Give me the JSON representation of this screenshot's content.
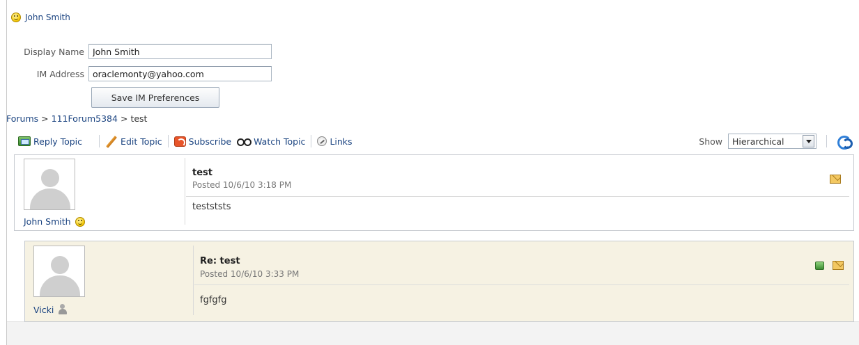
{
  "header": {
    "user_name": "John Smith"
  },
  "im_form": {
    "display_name_label": "Display Name",
    "display_name_value": "John Smith",
    "im_address_label": "IM Address",
    "im_address_value": "oraclemonty@yahoo.com",
    "save_label": "Save IM Preferences"
  },
  "breadcrumb": {
    "forums": "Forums",
    "sep1": ">",
    "forum": "111Forum5384",
    "sep2": ">",
    "topic": "test"
  },
  "toolbar": {
    "reply": "Reply Topic",
    "edit": "Edit Topic",
    "subscribe": "Subscribe",
    "watch": "Watch Topic",
    "links": "Links",
    "show_label": "Show",
    "show_value": "Hierarchical"
  },
  "posts": [
    {
      "author": "John Smith",
      "title": "test",
      "posted": "Posted 10/6/10 3:18 PM",
      "body": "testststs"
    },
    {
      "author": "Vicki",
      "title": "Re: test",
      "posted": "Posted 10/6/10 3:33 PM",
      "body": "fgfgfg"
    }
  ]
}
